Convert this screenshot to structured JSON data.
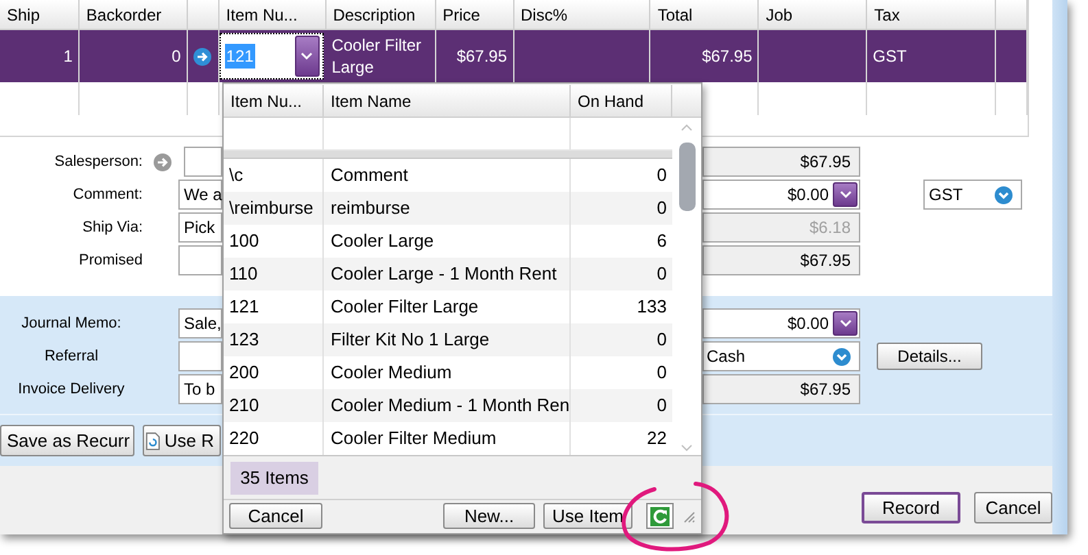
{
  "grid": {
    "columns": [
      "Ship",
      "Backorder",
      "Item Nu...",
      "Description",
      "Price",
      "Disc%",
      "Total",
      "Job",
      "Tax"
    ],
    "rows": [
      {
        "selected": true,
        "ship": "1",
        "backorder": "0",
        "item_number": "121",
        "description": "Cooler Filter Large",
        "price": "$67.95",
        "total": "$67.95",
        "tax": "GST"
      },
      {
        "selected": false
      }
    ]
  },
  "details": {
    "left": [
      {
        "label": "Salesperson:",
        "kind": "lookup"
      },
      {
        "label": "Comment:",
        "kind": "text",
        "value": "We a"
      },
      {
        "label": "Ship Via:",
        "kind": "text",
        "value": "Pick"
      },
      {
        "label": "Promised",
        "kind": "text"
      }
    ],
    "right": [
      {
        "kind": "amount",
        "value": "$67.95",
        "disabled": false
      },
      {
        "kind": "dropdown",
        "value": "$0.00",
        "disabled": false
      },
      {
        "kind": "amount",
        "value": "$6.18",
        "disabled": true
      },
      {
        "kind": "amount",
        "value": "$67.95",
        "disabled": false
      }
    ],
    "tax_code": "GST"
  },
  "journal": {
    "left": [
      {
        "label": "Journal Memo:",
        "value": "Sale,"
      },
      {
        "label": "Referral"
      },
      {
        "label": "Invoice Delivery",
        "value": "To b"
      }
    ],
    "right": [
      {
        "kind": "dropdown",
        "value": "$0.00",
        "disabled": false
      },
      {
        "kind": "select",
        "value": "Cash",
        "disabled": false
      },
      {
        "kind": "amount",
        "value": "$67.95",
        "disabled": false
      }
    ],
    "details_button": "Details..."
  },
  "actions": [
    "Save as Recurr",
    "Use R"
  ],
  "footer_buttons": [
    {
      "label": "Record",
      "default": true
    },
    {
      "label": "Cancel",
      "default": false
    }
  ],
  "item_lookup": {
    "columns": [
      "Item Nu...",
      "Item Name",
      "On Hand"
    ],
    "items": [
      {
        "number": "\\c",
        "name": "Comment",
        "on_hand": "0"
      },
      {
        "number": "\\reimburse",
        "name": "reimburse",
        "on_hand": "0"
      },
      {
        "number": "100",
        "name": "Cooler Large",
        "on_hand": "6"
      },
      {
        "number": "110",
        "name": "Cooler Large - 1 Month Rent",
        "on_hand": "0"
      },
      {
        "number": "121",
        "name": "Cooler Filter Large",
        "on_hand": "133"
      },
      {
        "number": "123",
        "name": "Filter Kit No 1 Large",
        "on_hand": "0"
      },
      {
        "number": "200",
        "name": "Cooler Medium",
        "on_hand": "0"
      },
      {
        "number": "210",
        "name": "Cooler Medium - 1 Month Ren",
        "on_hand": "0"
      },
      {
        "number": "220",
        "name": "Cooler Filter Medium",
        "on_hand": "22"
      }
    ],
    "count": "35 Items",
    "buttons": [
      "Cancel",
      "New...",
      "Use Item"
    ]
  }
}
